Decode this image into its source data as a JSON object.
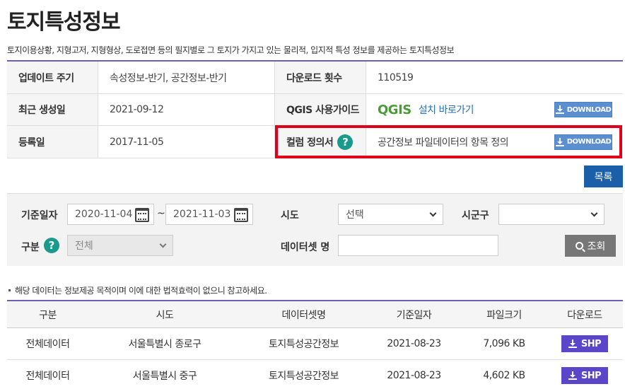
{
  "page": {
    "title": "토지특성정보",
    "description": "토지이용상황, 지형고저, 지형형상, 도로접면 등의 필지별로 그 토지가 가지고 있는 물리적, 입지적 특성 정보를 제공하는 토지특성정보"
  },
  "info": {
    "update_cycle_label": "업데이트 주기",
    "update_cycle_value": "속성정보-반기, 공간정보-반기",
    "download_count_label": "다운로드 횟수",
    "download_count_value": "110519",
    "last_created_label": "최근 생성일",
    "last_created_value": "2021-09-12",
    "qgis_label": "QGIS 사용가이드",
    "qgis_logo": "QGIS",
    "qgis_link": "설치 바로가기",
    "registered_label": "등록일",
    "registered_value": "2017-11-05",
    "column_def_label": "컬럼 정의서",
    "column_def_value": "공간정보 파일데이터의 항목 정의",
    "download_label": "DOWNLOAD"
  },
  "list_button": "목록",
  "search": {
    "date_label": "기준일자",
    "date_from": "2020-11-04",
    "date_to": "2021-11-03",
    "tilde": "~",
    "sido_label": "시도",
    "sido_value": "선택",
    "sigungu_label": "시군구",
    "sigungu_value": "",
    "type_label": "구분",
    "type_value": "전체",
    "dataset_label": "데이터셋 명",
    "dataset_value": "",
    "search_button": "조회"
  },
  "notice": "해당 데이터는 정보제공 목적이며 이에 대한 법적효력이 없으니 참고하세요.",
  "table": {
    "headers": [
      "구분",
      "시도",
      "데이터셋명",
      "기준일자",
      "파일크기",
      "다운로드"
    ],
    "rows": [
      {
        "type": "전체데이터",
        "sido": "서울특별시 종로구",
        "dataset": "토지특성공간정보",
        "date": "2021-08-23",
        "size": "7,096 KB",
        "download": "SHP"
      },
      {
        "type": "전체데이터",
        "sido": "서울특별시 중구",
        "dataset": "토지특성공간정보",
        "date": "2021-08-23",
        "size": "4,602 KB",
        "download": "SHP"
      }
    ]
  },
  "colors": {
    "accent_purple": "#6c5fb0",
    "highlight_red": "#e0001a",
    "list_button_blue": "#1a5fa8",
    "shp_button": "#5b45c8",
    "help_teal": "#1a9a8a"
  }
}
